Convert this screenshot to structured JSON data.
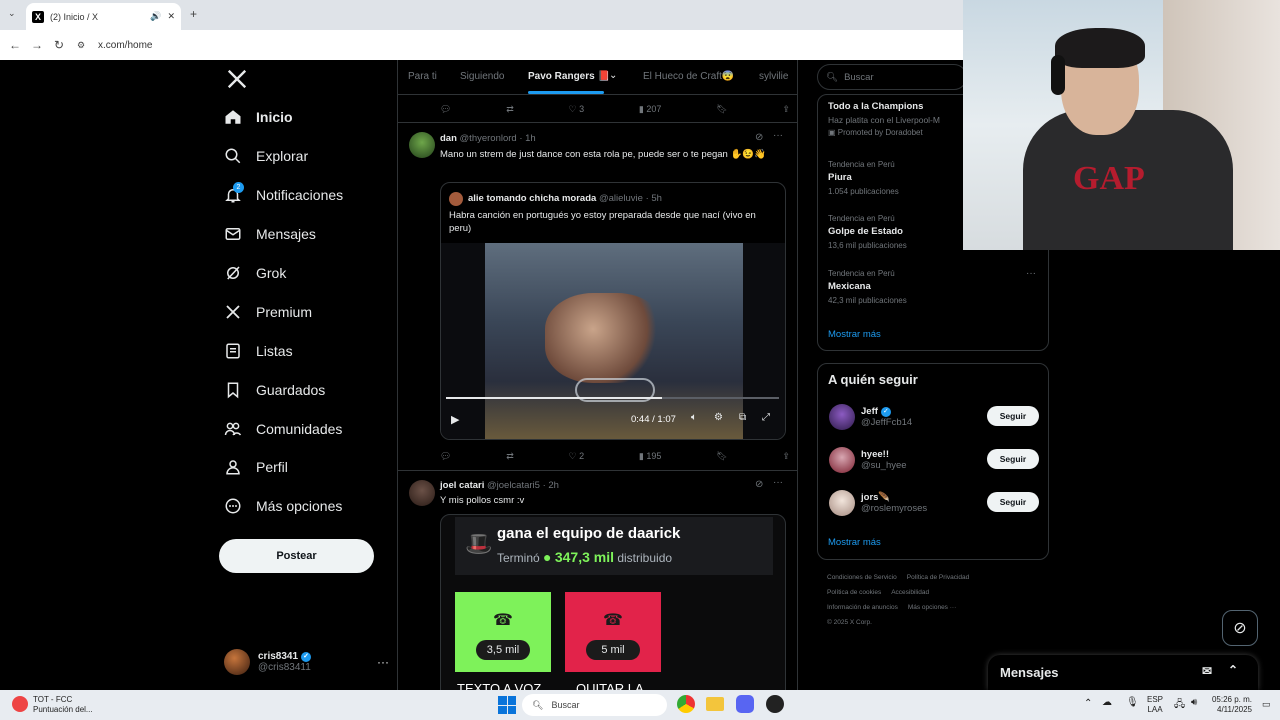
{
  "browser": {
    "tab_title": "(2) Inicio / X",
    "url": "x.com/home"
  },
  "nav": {
    "items": [
      {
        "label": "Inicio",
        "icon": "home-icon"
      },
      {
        "label": "Explorar",
        "icon": "search-icon"
      },
      {
        "label": "Notificaciones",
        "icon": "bell-icon",
        "badge": "2"
      },
      {
        "label": "Mensajes",
        "icon": "mail-icon"
      },
      {
        "label": "Grok",
        "icon": "grok-icon"
      },
      {
        "label": "Premium",
        "icon": "x-icon"
      },
      {
        "label": "Listas",
        "icon": "list-icon"
      },
      {
        "label": "Guardados",
        "icon": "bookmark-icon"
      },
      {
        "label": "Comunidades",
        "icon": "people-icon"
      },
      {
        "label": "Perfil",
        "icon": "person-icon"
      },
      {
        "label": "Más opciones",
        "icon": "more-circle-icon"
      }
    ],
    "post_button": "Postear",
    "account": {
      "name": "cris8341",
      "handle": "@cris83411"
    }
  },
  "feed": {
    "tabs": [
      "Para ti",
      "Siguiendo",
      "Pavo Rangers 📕",
      "El Hueco de Craft😨",
      "sylvilie"
    ],
    "top_actions": {
      "likes": "3",
      "views": "207"
    },
    "tweet1": {
      "name": "dan",
      "handle": "@thyeronlord",
      "time": "· 1h",
      "text": "Mano un strem de just dance con esta rola pe, puede ser o te pegan ✋😉👋",
      "quote": {
        "name": "alie tomando chicha morada",
        "handle": "@alieluvie",
        "time": "· 5h",
        "text": "Habra canción en portugués yo estoy preparada desde que nací (vivo en peru)"
      },
      "video_time": "0:44 / 1:07",
      "video_progress": 0.65,
      "likes": "2",
      "views": "195"
    },
    "tweet2": {
      "name": "joel catari",
      "handle": "@joelcatari5",
      "time": "· 2h",
      "text": "Y mis pollos csmr :v",
      "card": {
        "title": "gana el equipo de daarick",
        "status": "Terminó",
        "amount": "347,3 mil",
        "suffix": "distribuido",
        "option1_value": "3,5 mil",
        "option1_label": "TEXTO A VOZ",
        "option2_value": "5 mil",
        "option2_label": "QUITAR LA"
      }
    }
  },
  "right": {
    "search_placeholder": "Buscar",
    "promo": {
      "title": "Todo a la Champions",
      "sub": "Haz platita con el Liverpool-M",
      "promoted": "Promoted by Doradobet"
    },
    "trends": [
      {
        "meta": "Tendencia en Perú",
        "name": "Piura",
        "count": "1.054 publicaciones"
      },
      {
        "meta": "Tendencia en Perú",
        "name": "Golpe de Estado",
        "count": "13,6 mil publicaciones"
      },
      {
        "meta": "Tendencia en Perú",
        "name": "Mexicana",
        "count": "42,3 mil publicaciones"
      }
    ],
    "show_more": "Mostrar más",
    "who_to_follow_title": "A quién seguir",
    "follow": [
      {
        "name": "Jeff",
        "handle": "@JeffFcb14",
        "verified": true
      },
      {
        "name": "hyee!!",
        "handle": "@su_hyee",
        "verified": false
      },
      {
        "name": "jors🪶",
        "handle": "@roslemyroses",
        "verified": false
      }
    ],
    "follow_button": "Seguir",
    "show_more2": "Mostrar más",
    "footer": [
      "Condiciones de Servicio",
      "Política de Privacidad",
      "Política de cookies",
      "Accesibilidad",
      "Información de anuncios",
      "Más opciones ···",
      "© 2025 X Corp."
    ],
    "messages_title": "Mensajes"
  },
  "taskbar": {
    "app_title": "TOT - FCC",
    "app_sub": "Puntuación del...",
    "search": "Buscar",
    "lang": "ESP",
    "lang2": "LAA",
    "time": "05:26 p. m.",
    "date": "4/11/2025"
  },
  "colors": {
    "accent": "#1d9bf0",
    "poll_green": "#7ef25a",
    "poll_red": "#e2234a"
  }
}
